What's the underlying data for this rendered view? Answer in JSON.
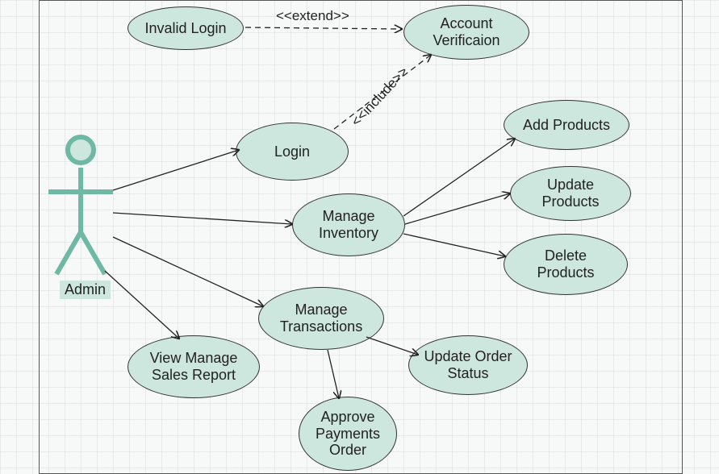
{
  "diagram": {
    "actor": {
      "name": "Admin"
    },
    "usecases": {
      "invalid_login": "Invalid Login",
      "account_verification": "Account\nVerificaion",
      "login": "Login",
      "manage_inventory": "Manage\nInventory",
      "add_products": "Add Products",
      "update_products": "Update\nProducts",
      "delete_products": "Delete\nProducts",
      "manage_transactions": "Manage\nTransactions",
      "view_sales_report": "View Manage\nSales Report",
      "update_order_status": "Update Order\nStatus",
      "approve_payments": "Approve\nPayments\nOrder"
    },
    "relations": {
      "extend": "<<extend>>",
      "include": "<<include>>"
    }
  }
}
